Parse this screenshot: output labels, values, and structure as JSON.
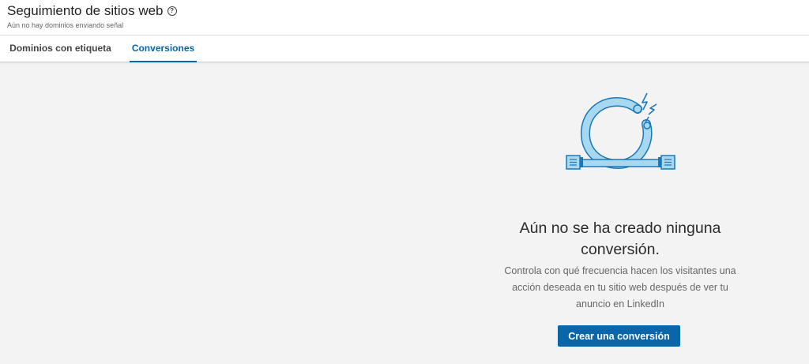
{
  "header": {
    "title": "Seguimiento de sitios web",
    "help_icon": "question-circle-icon",
    "subtitle": "Aún no hay dominios enviando señal"
  },
  "tabs": [
    {
      "label": "Dominios con etiqueta",
      "active": false
    },
    {
      "label": "Conversiones",
      "active": true
    }
  ],
  "empty_state": {
    "illustration_icon": "looped-cable-spark-icon",
    "heading": "Aún no se ha creado ninguna conversión.",
    "description": "Controla con qué frecuencia hacen los visitantes una acción deseada en tu sitio web después de ver tu anuncio en LinkedIn",
    "cta_label": "Crear una conversión"
  },
  "colors": {
    "accent": "#0a66a8",
    "illustration_fill": "#a8d8f0",
    "illustration_stroke": "#1b78b8",
    "background": "#f3f3f3"
  }
}
